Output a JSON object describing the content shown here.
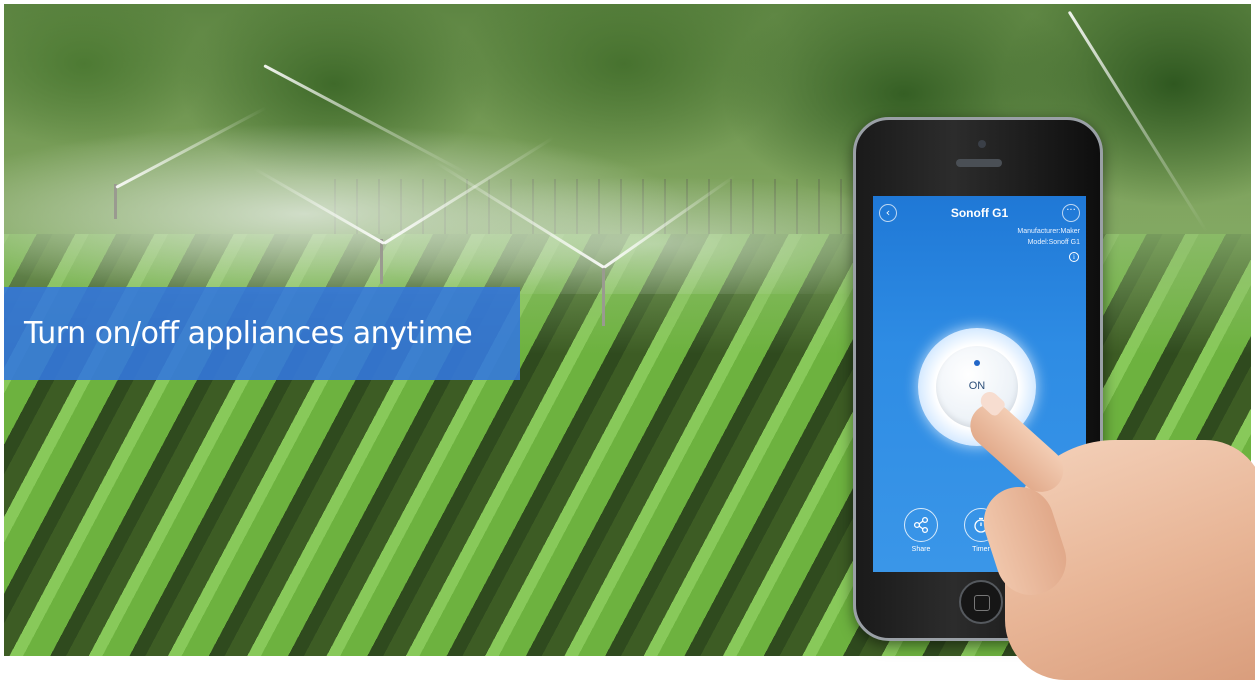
{
  "banner": {
    "text": "Turn on/off appliances anytime"
  },
  "app": {
    "device_name": "Sonoff G1",
    "manufacturer": "Manufacturer:Maker",
    "model": "Model:Sonoff G1",
    "power_state": "ON",
    "actions": [
      {
        "label": "Share",
        "icon": "share-icon"
      },
      {
        "label": "Timer",
        "icon": "timer-icon"
      }
    ]
  },
  "colors": {
    "banner": "#3478dc",
    "screen": "#2e8ce4",
    "power_dot": "#2266c8"
  }
}
